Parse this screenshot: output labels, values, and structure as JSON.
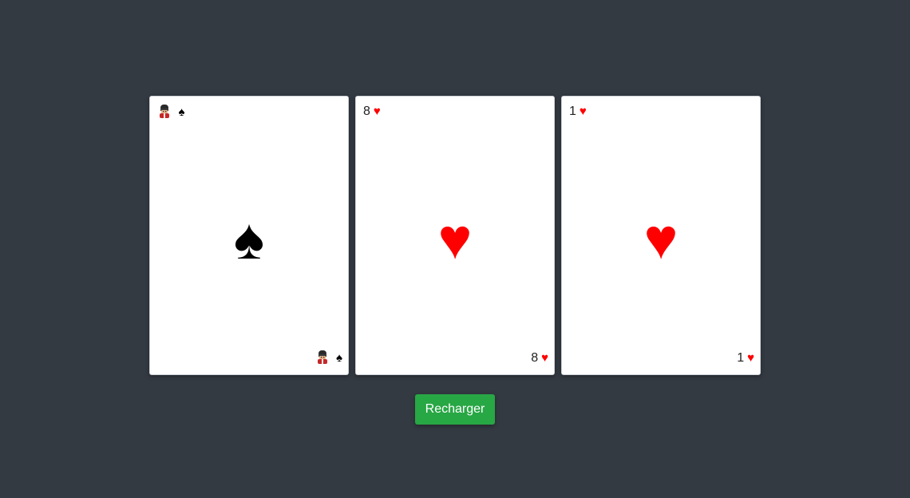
{
  "colors": {
    "background": "#343a42",
    "card": "#ffffff",
    "black_suit": "#000000",
    "red_suit": "#ff0000",
    "button": "#28a745"
  },
  "cards": [
    {
      "rank": "",
      "rank_icon": "guard-icon",
      "suit": "♠",
      "suit_name": "spade-icon",
      "suit_color": "#000000"
    },
    {
      "rank": "8",
      "suit": "♥",
      "suit_name": "heart-icon",
      "suit_color": "#ff0000"
    },
    {
      "rank": "1",
      "suit": "♥",
      "suit_name": "heart-icon",
      "suit_color": "#ff0000"
    }
  ],
  "reload_button": {
    "label": "Recharger"
  }
}
